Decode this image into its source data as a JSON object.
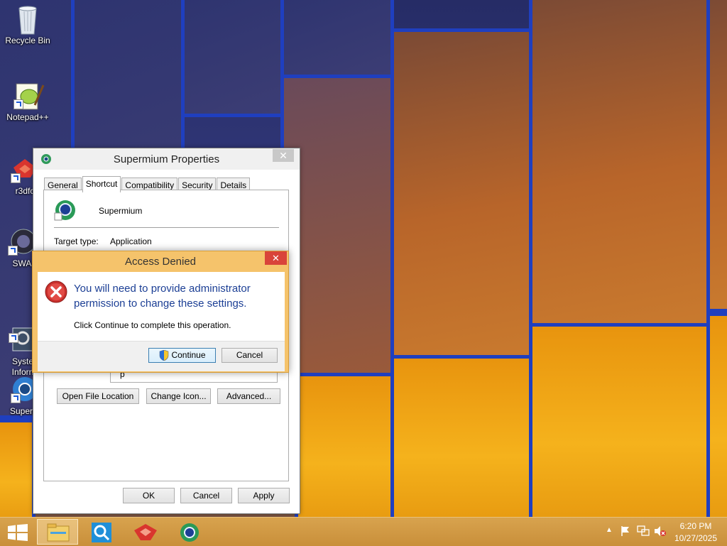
{
  "desktop_icons": [
    {
      "label": "Recycle Bin",
      "icon": "recycle-bin-icon"
    },
    {
      "label": "Notepad++",
      "icon": "notepad-plus-plus-icon"
    },
    {
      "label": "r3dfc",
      "icon": "r3dfox-icon"
    },
    {
      "label": "SWA",
      "icon": "swa-icon"
    },
    {
      "label": "Syste\nInforn",
      "icon": "system-information-icon"
    },
    {
      "label": "Superm",
      "icon": "supermium-icon"
    }
  ],
  "properties_window": {
    "title": "Supermium Properties",
    "tabs": [
      "General",
      "Shortcut",
      "Compatibility",
      "Security",
      "Details"
    ],
    "active_tab": "Shortcut",
    "app_name": "Supermium",
    "target_type_label": "Target type:",
    "target_type_value": "Application",
    "partial_field_text": "p",
    "buttons": {
      "open_file_location": "Open File Location",
      "change_icon": "Change Icon...",
      "advanced": "Advanced...",
      "ok": "OK",
      "cancel": "Cancel",
      "apply": "Apply"
    },
    "close_glyph": "✕"
  },
  "access_denied": {
    "title": "Access Denied",
    "message": "You will need to provide administrator permission to change these settings.",
    "sub_message": "Click Continue to complete this operation.",
    "continue_label": "Continue",
    "cancel_label": "Cancel",
    "close_glyph": "✕"
  },
  "taskbar": {
    "time": "6:20 PM",
    "date": "10/27/2025",
    "pinned": [
      "file-explorer-icon",
      "search-magnifier-icon",
      "r3dfox-icon",
      "supermium-icon"
    ],
    "colors": {
      "accent": "#c98f3a"
    }
  }
}
